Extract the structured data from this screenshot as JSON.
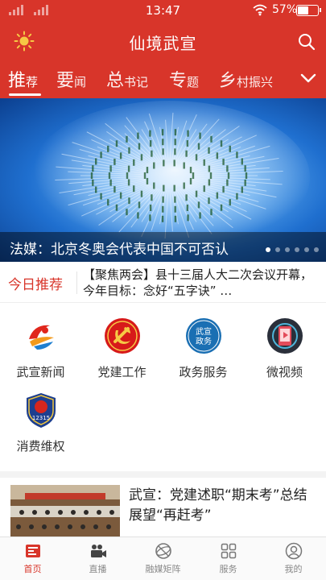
{
  "status_bar": {
    "time": "13:47",
    "battery_text": "57%",
    "battery_level": 0.57
  },
  "header": {
    "title": "仙境武宣",
    "left_icon": "sun-icon",
    "right_icon": "search-icon"
  },
  "tabs": [
    {
      "big": "推",
      "small": "荐",
      "active": true
    },
    {
      "big": "要",
      "small": "闻",
      "active": false
    },
    {
      "big": "总",
      "small": "书记",
      "active": false
    },
    {
      "big": "专",
      "small": "题",
      "active": false
    },
    {
      "big": "乡",
      "small": "村振兴",
      "active": false
    }
  ],
  "banner": {
    "caption": "法媒：北京冬奥会代表中国不可否认",
    "slide_count": 6,
    "active_slide": 1
  },
  "today": {
    "label": "今日推荐",
    "text": "【聚焦两会】县十三届人大二次会议开幕，今年目标：念好“五字诀” …"
  },
  "services": [
    {
      "label": "武宣新闻",
      "icon": "wuxuan-news-logo-icon"
    },
    {
      "label": "党建工作",
      "icon": "party-emblem-icon"
    },
    {
      "label": "政务服务",
      "icon": "government-service-icon",
      "icon_text": [
        "武宣",
        "政务"
      ]
    },
    {
      "label": "微视频",
      "icon": "micro-video-icon"
    },
    {
      "label": "消费维权",
      "icon": "consumer-rights-icon",
      "icon_text": "12315"
    }
  ],
  "news": [
    {
      "title": "武宣：党建述职“期末考”总结展望“再赶考”"
    }
  ],
  "bottom_nav": [
    {
      "label": "首页",
      "icon": "home-icon",
      "active": true
    },
    {
      "label": "直播",
      "icon": "video-camera-icon",
      "active": false
    },
    {
      "label": "融媒矩阵",
      "icon": "globe-icon",
      "active": false
    },
    {
      "label": "服务",
      "icon": "grid-icon",
      "active": false
    },
    {
      "label": "我的",
      "icon": "user-icon",
      "active": false
    }
  ],
  "colors": {
    "brand": "#d8352a",
    "party_red": "#d71a1a",
    "gold": "#f6c945",
    "gov_blue": "#1a6fb3"
  }
}
